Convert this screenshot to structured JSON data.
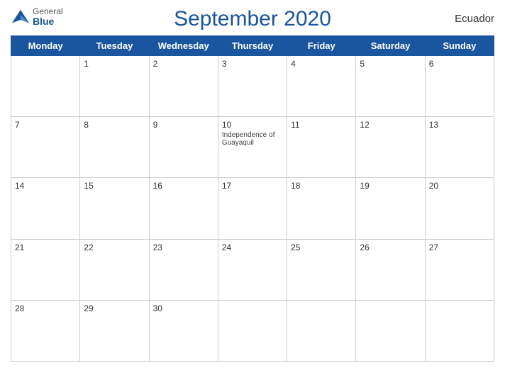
{
  "header": {
    "title": "September 2020",
    "country": "Ecuador",
    "logo_general": "General",
    "logo_blue": "Blue"
  },
  "weekdays": [
    "Monday",
    "Tuesday",
    "Wednesday",
    "Thursday",
    "Friday",
    "Saturday",
    "Sunday"
  ],
  "weeks": [
    [
      {
        "day": "",
        "empty": true
      },
      {
        "day": "1"
      },
      {
        "day": "2"
      },
      {
        "day": "3"
      },
      {
        "day": "4"
      },
      {
        "day": "5"
      },
      {
        "day": "6"
      }
    ],
    [
      {
        "day": "7"
      },
      {
        "day": "8"
      },
      {
        "day": "9"
      },
      {
        "day": "10",
        "event": "Independence of Guayaquil"
      },
      {
        "day": "11"
      },
      {
        "day": "12"
      },
      {
        "day": "13"
      }
    ],
    [
      {
        "day": "14"
      },
      {
        "day": "15"
      },
      {
        "day": "16"
      },
      {
        "day": "17"
      },
      {
        "day": "18"
      },
      {
        "day": "19"
      },
      {
        "day": "20"
      }
    ],
    [
      {
        "day": "21"
      },
      {
        "day": "22"
      },
      {
        "day": "23"
      },
      {
        "day": "24"
      },
      {
        "day": "25"
      },
      {
        "day": "26"
      },
      {
        "day": "27"
      }
    ],
    [
      {
        "day": "28"
      },
      {
        "day": "29"
      },
      {
        "day": "30"
      },
      {
        "day": "",
        "empty": true
      },
      {
        "day": "",
        "empty": true
      },
      {
        "day": "",
        "empty": true
      },
      {
        "day": "",
        "empty": true
      }
    ]
  ],
  "colors": {
    "header_bg": "#1a56a0",
    "header_text": "#ffffff",
    "title_color": "#1a56a0"
  }
}
